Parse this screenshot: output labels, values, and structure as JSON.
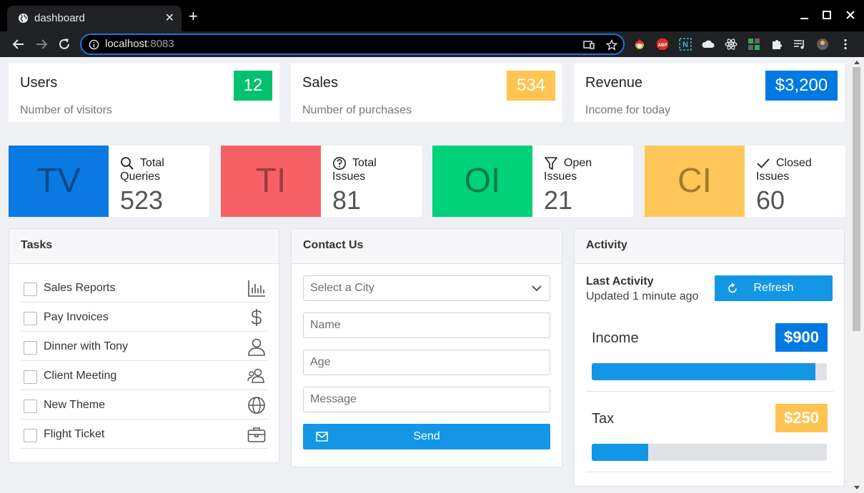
{
  "browser": {
    "tab_title": "dashboard",
    "url_host": "localhost",
    "url_port": ":8083"
  },
  "stats": [
    {
      "title": "Users",
      "subtitle": "Number of visitors",
      "badge": "12",
      "color": "#00c16e"
    },
    {
      "title": "Sales",
      "subtitle": "Number of purchases",
      "badge": "534",
      "color": "#ffc452"
    },
    {
      "title": "Revenue",
      "subtitle": "Income for today",
      "badge": "$3,200",
      "color": "#0079e1"
    }
  ],
  "metrics": [
    {
      "abbr": "TV",
      "label": "Total Queries",
      "value": "523",
      "icon": "search-icon",
      "bg": "#0a7ae2",
      "fg": "#0a4a8c"
    },
    {
      "abbr": "TI",
      "label": "Total Issues",
      "value": "81",
      "icon": "question-circle-icon",
      "bg": "#f66168",
      "fg": "#a13a3e"
    },
    {
      "abbr": "OI",
      "label": "Open Issues",
      "value": "21",
      "icon": "filter-icon",
      "bg": "#00d27a",
      "fg": "#0a7a46"
    },
    {
      "abbr": "CI",
      "label": "Closed Issues",
      "value": "60",
      "icon": "check-icon",
      "bg": "#ffc65a",
      "fg": "#a47a2b"
    }
  ],
  "tasks": {
    "title": "Tasks",
    "items": [
      {
        "label": "Sales Reports",
        "icon": "bar-chart-icon"
      },
      {
        "label": "Pay Invoices",
        "icon": "dollar-icon"
      },
      {
        "label": "Dinner with Tony",
        "icon": "user-icon"
      },
      {
        "label": "Client Meeting",
        "icon": "users-icon"
      },
      {
        "label": "New Theme",
        "icon": "globe-icon"
      },
      {
        "label": "Flight Ticket",
        "icon": "briefcase-icon"
      }
    ]
  },
  "contact": {
    "title": "Contact Us",
    "city_placeholder": "Select a City",
    "name_placeholder": "Name",
    "age_placeholder": "Age",
    "message_placeholder": "Message",
    "send_label": "Send"
  },
  "activity": {
    "title": "Activity",
    "last_title": "Last Activity",
    "last_sub": "Updated 1 minute ago",
    "refresh_label": "Refresh",
    "rows": [
      {
        "label": "Income",
        "badge": "$900",
        "badge_color": "#0079e1",
        "progress": 0.95
      },
      {
        "label": "Tax",
        "badge": "$250",
        "badge_color": "#ffc452",
        "progress": 0.24
      }
    ]
  }
}
